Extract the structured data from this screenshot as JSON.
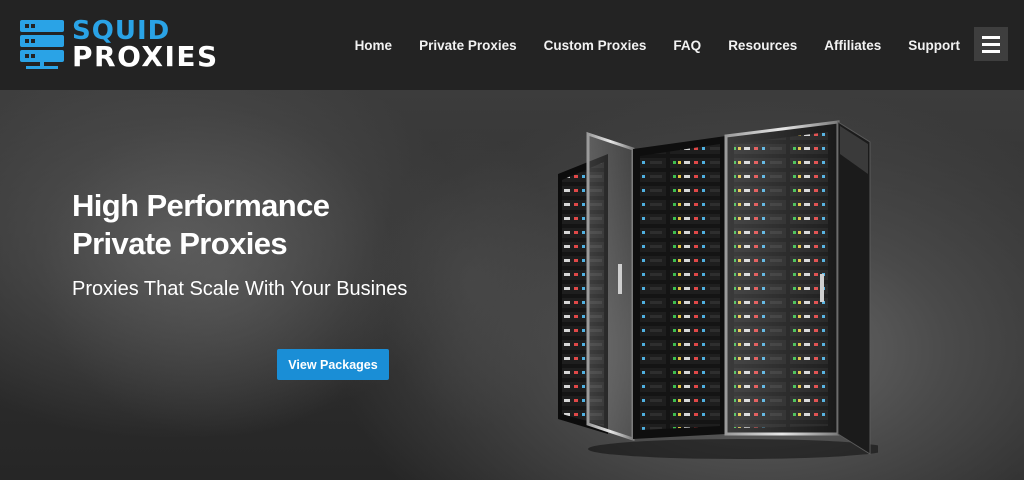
{
  "brand": {
    "line1": "SQUID",
    "line2": "PROXIES",
    "accent_color": "#2aa3e6",
    "icon": "server-stack-icon"
  },
  "nav": {
    "items": [
      {
        "label": "Home"
      },
      {
        "label": "Private Proxies"
      },
      {
        "label": "Custom Proxies"
      },
      {
        "label": "FAQ"
      },
      {
        "label": "Resources"
      },
      {
        "label": "Affiliates"
      },
      {
        "label": "Support"
      }
    ],
    "menu_icon": "hamburger-menu-icon"
  },
  "hero": {
    "title_line1": "High Performance",
    "title_line2": "Private Proxies",
    "subtitle": "Proxies That Scale With Your Busines",
    "cta_label": "View Packages",
    "cta_color": "#1a8ed6",
    "image": "server-racks-illustration"
  }
}
